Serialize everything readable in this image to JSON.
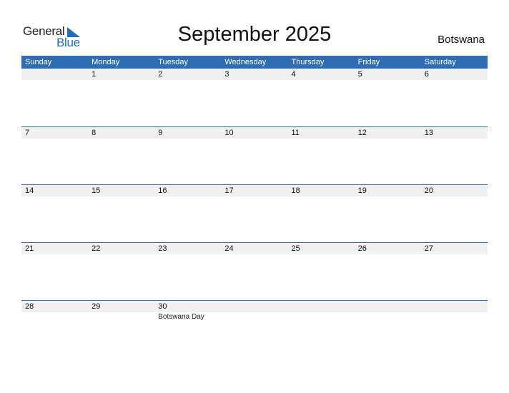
{
  "logo": {
    "line1": "General",
    "line2": "Blue"
  },
  "title": "September 2025",
  "country": "Botswana",
  "colors": {
    "accent": "#2e6db4",
    "row_bg": "#f0f0f0",
    "logo_blue": "#1f6fbf"
  },
  "weekdays": [
    "Sunday",
    "Monday",
    "Tuesday",
    "Wednesday",
    "Thursday",
    "Friday",
    "Saturday"
  ],
  "weeks": [
    {
      "days": [
        "",
        "1",
        "2",
        "3",
        "4",
        "5",
        "6"
      ],
      "events": [
        "",
        "",
        "",
        "",
        "",
        "",
        ""
      ]
    },
    {
      "days": [
        "7",
        "8",
        "9",
        "10",
        "11",
        "12",
        "13"
      ],
      "events": [
        "",
        "",
        "",
        "",
        "",
        "",
        ""
      ]
    },
    {
      "days": [
        "14",
        "15",
        "16",
        "17",
        "18",
        "19",
        "20"
      ],
      "events": [
        "",
        "",
        "",
        "",
        "",
        "",
        ""
      ]
    },
    {
      "days": [
        "21",
        "22",
        "23",
        "24",
        "25",
        "26",
        "27"
      ],
      "events": [
        "",
        "",
        "",
        "",
        "",
        "",
        ""
      ]
    },
    {
      "days": [
        "28",
        "29",
        "30",
        "",
        "",
        "",
        ""
      ],
      "events": [
        "",
        "",
        "Botswana Day",
        "",
        "",
        "",
        ""
      ]
    }
  ]
}
